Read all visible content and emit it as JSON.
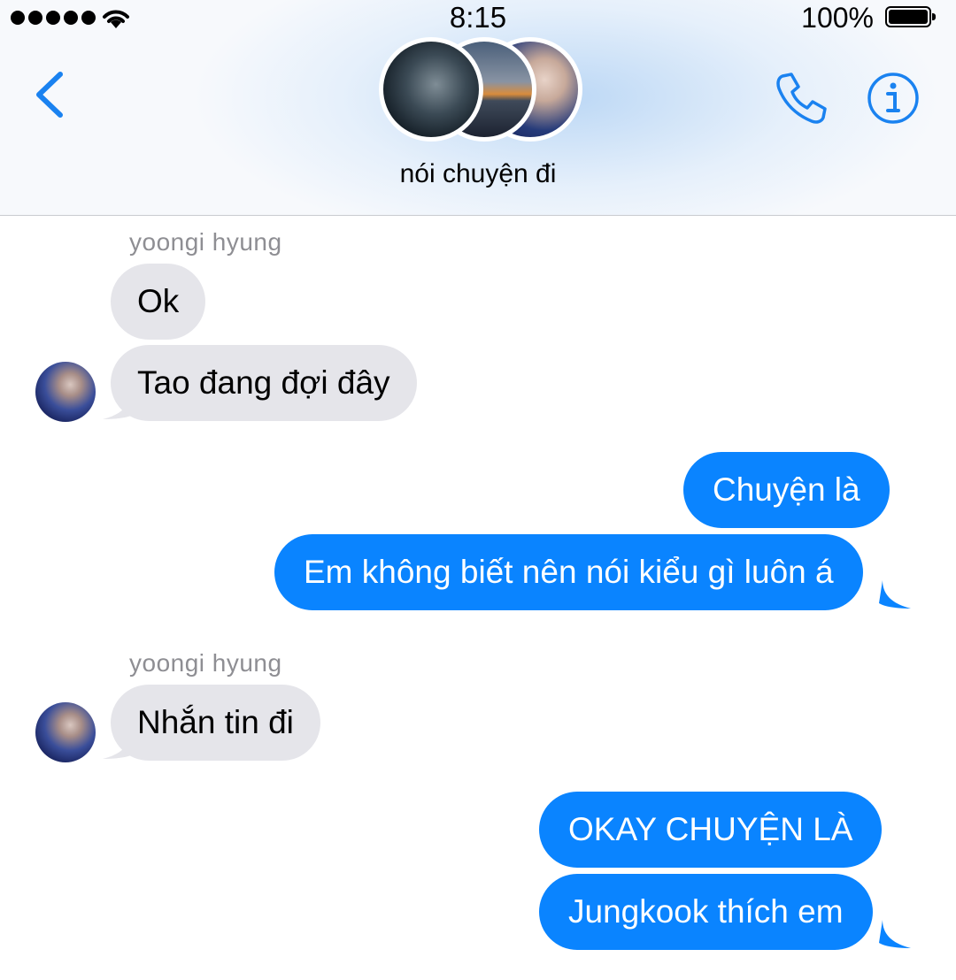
{
  "status_bar": {
    "time": "8:15",
    "battery_percent": "100%",
    "signal_bars": 5,
    "battery_level": 1.0
  },
  "header": {
    "chat_title": "nói chuyện đi",
    "icons": [
      "back-chevron-icon",
      "phone-icon",
      "info-icon"
    ],
    "accent_color": "#1a82f0"
  },
  "messages": [
    {
      "direction": "incoming",
      "sender": "yoongi hyung",
      "text": "Ok"
    },
    {
      "direction": "incoming",
      "text": "Tao đang đợi đây"
    },
    {
      "direction": "outgoing",
      "text": "Chuyện là"
    },
    {
      "direction": "outgoing",
      "text": "Em không biết nên nói kiểu gì luôn á"
    },
    {
      "direction": "incoming",
      "sender": "yoongi hyung",
      "text": "Nhắn tin đi"
    },
    {
      "direction": "outgoing",
      "text": "OKAY CHUYỆN LÀ"
    },
    {
      "direction": "outgoing",
      "text": "Jungkook thích em"
    }
  ],
  "colors": {
    "incoming_bubble": "#e5e5ea",
    "outgoing_bubble": "#0a84ff",
    "sender_label": "#8e8e93"
  }
}
